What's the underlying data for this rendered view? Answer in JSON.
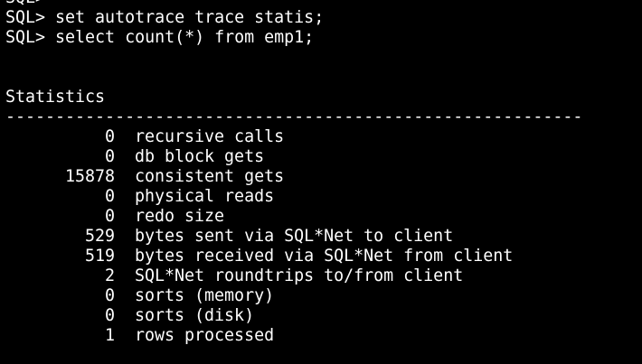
{
  "terminal": {
    "lines": [
      "SQL>",
      "SQL> set autotrace trace statis;",
      "SQL> select count(*) from emp1;",
      "",
      "",
      "Statistics",
      "----------------------------------------------------------"
    ],
    "statistics": [
      {
        "value": "0",
        "label": "recursive calls"
      },
      {
        "value": "0",
        "label": "db block gets"
      },
      {
        "value": "15878",
        "label": "consistent gets"
      },
      {
        "value": "0",
        "label": "physical reads"
      },
      {
        "value": "0",
        "label": "redo size"
      },
      {
        "value": "529",
        "label": "bytes sent via SQL*Net to client"
      },
      {
        "value": "519",
        "label": "bytes received via SQL*Net from client"
      },
      {
        "value": "2",
        "label": "SQL*Net roundtrips to/from client"
      },
      {
        "value": "0",
        "label": "sorts (memory)"
      },
      {
        "value": "0",
        "label": "sorts (disk)"
      },
      {
        "value": "1",
        "label": "rows processed"
      }
    ]
  }
}
